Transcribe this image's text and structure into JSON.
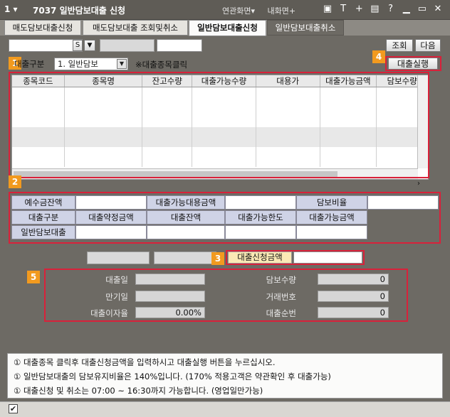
{
  "window": {
    "screen_no": "1",
    "title": "7037 일반담보대출 신청",
    "links": [
      "연관화면▾",
      "내화면+"
    ],
    "icons": [
      "screen-icon",
      "text-icon",
      "plus-icon",
      "print-icon",
      "help-icon",
      "minimize-icon",
      "maximize-icon",
      "close-icon"
    ]
  },
  "tabs": [
    {
      "label": "매도담보대출신청"
    },
    {
      "label": "매도담보대출 조회및취소"
    },
    {
      "label": "일반담보대출신청",
      "active": true
    },
    {
      "label": "일반담보대출취소"
    }
  ],
  "toolbar": {
    "account_value": "",
    "s_label": "S",
    "query_button": "조회",
    "next_button": "다음"
  },
  "loan_type": {
    "label": "대출구분",
    "selected": "1. 일반담보",
    "hint": "※대출종목클릭",
    "execute_button": "대출실행"
  },
  "grid": {
    "columns": [
      "종목코드",
      "종목명",
      "잔고수량",
      "대출가능수량",
      "대용가",
      "대출가능금액",
      "담보수량"
    ],
    "rows": []
  },
  "summary": {
    "deposit_label": "예수금잔액",
    "loan_avail_sub_label": "대출가능대용금액",
    "collateral_ratio_label": "담보비율",
    "headers": [
      "대출구분",
      "대출약정금액",
      "대출잔액",
      "대출가능한도",
      "대출가능금액"
    ],
    "row_label": "일반담보대출"
  },
  "request": {
    "label": "대출신청금액"
  },
  "details": {
    "loan_date_label": "대출일",
    "maturity_label": "만기일",
    "interest_label": "대출이자율",
    "interest_value": "0.00%",
    "collateral_qty_label": "담보수량",
    "collateral_qty_value": "0",
    "trade_no_label": "거래번호",
    "trade_no_value": "0",
    "loan_seq_label": "대출순번",
    "loan_seq_value": "0"
  },
  "badges": [
    "1",
    "2",
    "3",
    "4",
    "5"
  ],
  "notes": [
    "① 대출종목 클릭후 대출신청금액을 입력하시고 대출실행 버튼을 누르십시오.",
    "① 일반담보대출의 담보유지비율은 140%입니다. (170% 적용고객은 약관확인 후 대출가능)",
    "① 대출신청 및 취소는 07:00 ~ 16:30까지 가능합니다. (영업일만가능)"
  ],
  "status": {
    "checkbox": "✔"
  },
  "colors": {
    "accent_red": "#d9213a",
    "badge_orange": "#f29a1f",
    "bg_dark": "#6d6a64"
  }
}
